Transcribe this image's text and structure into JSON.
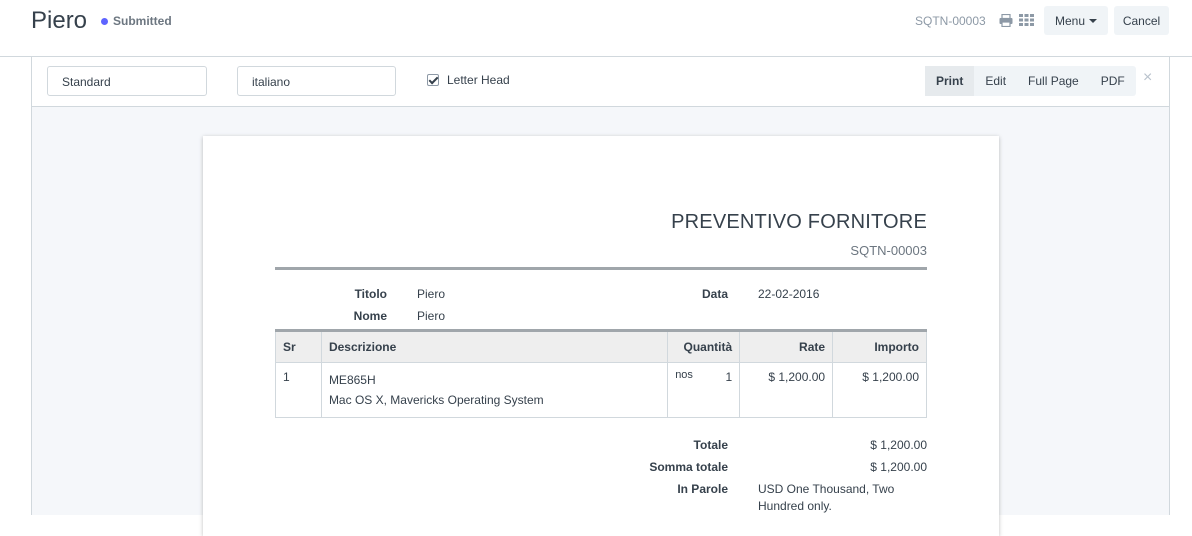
{
  "header": {
    "title": "Piero",
    "status": "Submitted",
    "docname": "SQTN-00003",
    "menu_label": "Menu",
    "cancel_label": "Cancel",
    "status_color": "#5e64ff"
  },
  "print_bar": {
    "format": "Standard",
    "language": "italiano",
    "letter_head_label": "Letter Head",
    "letter_head_checked": true,
    "buttons": [
      "Print",
      "Edit",
      "Full Page",
      "PDF"
    ],
    "close": "×"
  },
  "document": {
    "heading": "PREVENTIVO FORNITORE",
    "number": "SQTN-00003",
    "fields": {
      "titolo_label": "Titolo",
      "titolo_value": "Piero",
      "nome_label": "Nome",
      "nome_value": "Piero",
      "data_label": "Data",
      "data_value": "22-02-2016"
    },
    "table": {
      "headers": [
        "Sr",
        "Descrizione",
        "Quantità",
        "Rate",
        "Importo"
      ],
      "rows": [
        {
          "sr": "1",
          "code": "ME865H",
          "description": "Mac OS X, Mavericks Operating System",
          "uom": "nos",
          "qty": "1",
          "rate": "$ 1,200.00",
          "amount": "$ 1,200.00"
        }
      ]
    },
    "totals": {
      "totale_label": "Totale",
      "totale_value": "$ 1,200.00",
      "somma_label": "Somma totale",
      "somma_value": "$ 1,200.00",
      "words_label": "In Parole",
      "words_value": "USD One Thousand, Two Hundred only."
    }
  }
}
